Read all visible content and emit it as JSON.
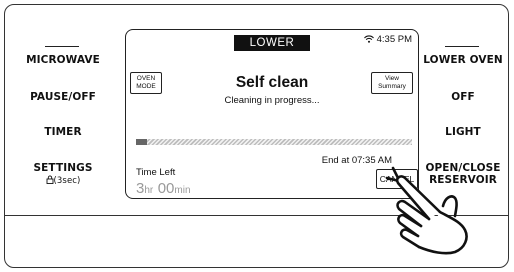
{
  "left_buttons": [
    {
      "label": "MICROWAVE",
      "sub": ""
    },
    {
      "label": "PAUSE/OFF",
      "sub": ""
    },
    {
      "label": "TIMER",
      "sub": ""
    },
    {
      "label": "SETTINGS",
      "sub": "(3sec)"
    }
  ],
  "right_buttons": [
    {
      "label": "LOWER OVEN"
    },
    {
      "label": "OFF"
    },
    {
      "label": "LIGHT"
    },
    {
      "label": "OPEN/CLOSE",
      "label2": "RESERVOIR"
    }
  ],
  "screen": {
    "badge": "LOWER",
    "clock": "4:35 PM",
    "oven_mode_button": "OVEN MODE",
    "view_summary_button": "View Summary",
    "title": "Self clean",
    "subtitle": "Cleaning in progress...",
    "progress_fraction": 0.04,
    "end_at": "End at 07:35 AM",
    "time_left_label": "Time Left",
    "time_left": {
      "hours": "3",
      "hours_unit": "hr",
      "minutes": "00",
      "minutes_unit": "min"
    },
    "cancel_button": "CANCEL"
  },
  "icons": {
    "wifi": "wifi-icon",
    "lock": "lock-icon",
    "hand": "pointing-hand-icon"
  }
}
